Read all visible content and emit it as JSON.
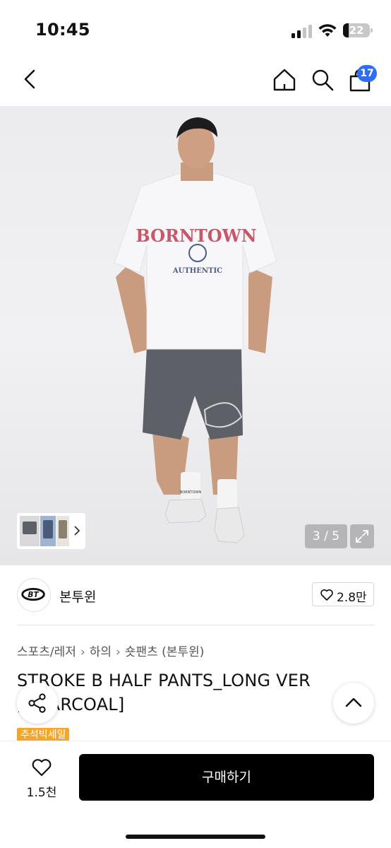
{
  "status_bar": {
    "time": "10:45",
    "battery_level": "22",
    "icons": [
      "signal-icon",
      "wifi-icon",
      "battery-icon"
    ]
  },
  "nav": {
    "icons": [
      "back-icon",
      "home-icon",
      "search-icon",
      "shopping-bag-icon"
    ],
    "cart_count": "17",
    "accent_color": "#2f6df6"
  },
  "gallery": {
    "current_page": 3,
    "total_pages": 5,
    "page_label": "3 / 5",
    "graphic_print": {
      "shirt_text": "BORNTOWN",
      "shirt_subtext": "AUTHENTIC",
      "sock_text": "BORNTOWN"
    }
  },
  "brand": {
    "name": "본투윈",
    "logo_text": "BT",
    "like_count": "2.8만"
  },
  "breadcrumb": [
    "스포츠/레저",
    "하의",
    "숏팬츠 (본투윈)"
  ],
  "product": {
    "title": "STROKE B HALF PANTS_LONG VER [CHARCOAL]",
    "sale_badge": "추석빅세일",
    "sale_badge_color": "#f4a62a"
  },
  "bottom_bar": {
    "wish_count": "1.5천",
    "buy_label": "구매하기"
  }
}
